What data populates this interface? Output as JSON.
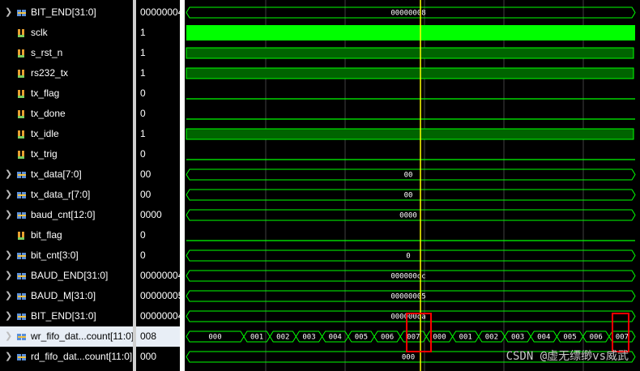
{
  "signals": [
    {
      "name": "BIT_END[31:0]",
      "value": "00000004",
      "kind": "bus",
      "expandable": true
    },
    {
      "name": "sclk",
      "value": "1",
      "kind": "bit",
      "expandable": false
    },
    {
      "name": "s_rst_n",
      "value": "1",
      "kind": "bit",
      "expandable": false
    },
    {
      "name": "rs232_tx",
      "value": "1",
      "kind": "bit",
      "expandable": false
    },
    {
      "name": "tx_flag",
      "value": "0",
      "kind": "bit",
      "expandable": false
    },
    {
      "name": "tx_done",
      "value": "0",
      "kind": "bit",
      "expandable": false
    },
    {
      "name": "tx_idle",
      "value": "1",
      "kind": "bit",
      "expandable": false
    },
    {
      "name": "tx_trig",
      "value": "0",
      "kind": "bit",
      "expandable": false
    },
    {
      "name": "tx_data[7:0]",
      "value": "00",
      "kind": "bus",
      "expandable": true
    },
    {
      "name": "tx_data_r[7:0]",
      "value": "00",
      "kind": "bus",
      "expandable": true
    },
    {
      "name": "baud_cnt[12:0]",
      "value": "0000",
      "kind": "bus",
      "expandable": true
    },
    {
      "name": "bit_flag",
      "value": "0",
      "kind": "bit",
      "expandable": false
    },
    {
      "name": "bit_cnt[3:0]",
      "value": "0",
      "kind": "bus",
      "expandable": true
    },
    {
      "name": "BAUD_END[31:0]",
      "value": "00000004",
      "kind": "bus",
      "expandable": true
    },
    {
      "name": "BAUD_M[31:0]",
      "value": "00000005",
      "kind": "bus",
      "expandable": true
    },
    {
      "name": "BIT_END[31:0]",
      "value": "00000004",
      "kind": "bus",
      "expandable": true
    },
    {
      "name": "wr_fifo_dat...count[11:0]",
      "value": "008",
      "kind": "bus",
      "expandable": true,
      "selected": true
    },
    {
      "name": "rd_fifo_dat...count[11:0]",
      "value": "000",
      "kind": "bus",
      "expandable": true
    }
  ],
  "waveforms": [
    {
      "type": "bus",
      "labels": [
        "00000008"
      ]
    },
    {
      "type": "clock"
    },
    {
      "type": "high"
    },
    {
      "type": "high"
    },
    {
      "type": "low"
    },
    {
      "type": "low"
    },
    {
      "type": "high"
    },
    {
      "type": "low"
    },
    {
      "type": "bus",
      "labels": [
        "00"
      ]
    },
    {
      "type": "bus",
      "labels": [
        "00"
      ]
    },
    {
      "type": "bus",
      "labels": [
        "0000"
      ]
    },
    {
      "type": "low"
    },
    {
      "type": "bus",
      "labels": [
        "0"
      ]
    },
    {
      "type": "bus",
      "labels": [
        "000000oc"
      ]
    },
    {
      "type": "bus",
      "labels": [
        "00000005"
      ]
    },
    {
      "type": "bus",
      "labels": [
        "000000oa"
      ]
    },
    {
      "type": "multi",
      "labels": [
        "000",
        "001",
        "002",
        "003",
        "004",
        "005",
        "006",
        "007",
        "000",
        "001",
        "002",
        "003",
        "004",
        "005",
        "006",
        "007"
      ]
    },
    {
      "type": "bus",
      "labels": [
        "000"
      ]
    }
  ],
  "watermark": "CSDN @虚无缥缈vs威武",
  "colors": {
    "wave": "#00ff00",
    "cursor": "#ffff00",
    "marker": "#ff0000",
    "background": "#000000",
    "selected_row": "#e8eef6"
  },
  "icons": {
    "bit": "logic-bit-icon",
    "bus": "bus-vector-icon",
    "expand": "chevron-right-icon"
  }
}
